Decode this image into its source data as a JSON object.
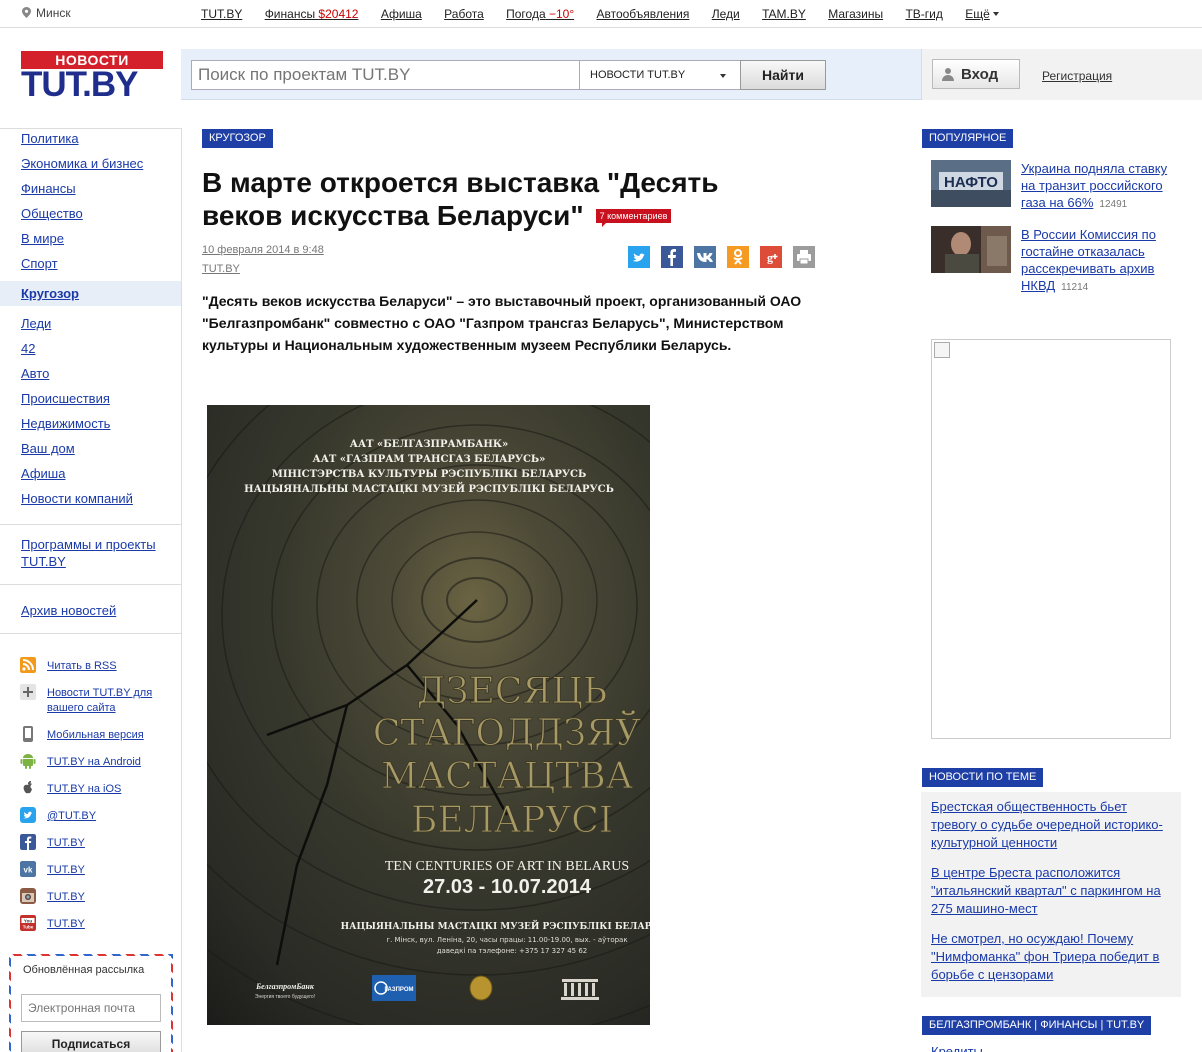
{
  "topbar": {
    "city": "Минск",
    "nav": [
      {
        "label": "TUT.BY"
      },
      {
        "label": "Финансы",
        "extra": "$20412"
      },
      {
        "label": "Афиша"
      },
      {
        "label": "Работа"
      },
      {
        "label": "Погода",
        "extra": "−10°"
      },
      {
        "label": "Автообъявления"
      },
      {
        "label": "Леди"
      },
      {
        "label": "TAM.BY"
      },
      {
        "label": "Магазины"
      },
      {
        "label": "ТВ-гид"
      },
      {
        "label": "Ещё"
      }
    ]
  },
  "header": {
    "logo_top": "НОВОСТИ",
    "logo_main": "TUT.BY",
    "search_placeholder": "Поиск по проектам TUT.BY",
    "search_scope": "НОВОСТИ TUT.BY",
    "search_button": "Найти",
    "login_button": "Вход",
    "register_link": "Регистрация"
  },
  "sidebar": {
    "nav": [
      "Политика",
      "Экономика и бизнес",
      "Финансы",
      "Общество",
      "В мире",
      "Спорт",
      "Кругозор",
      "Леди",
      "42",
      "Авто",
      "Происшествия",
      "Недвижимость",
      "Ваш дом",
      "Афиша",
      "Новости компаний"
    ],
    "active": "Кругозор",
    "programs": "Программы и проекты TUT.BY",
    "archive": "Архив новостей",
    "social": [
      {
        "icon": "rss-icon",
        "label": "Читать в RSS",
        "color": "#f29a1c"
      },
      {
        "icon": "plus-icon",
        "label": "Новости TUT.BY для вашего сайта",
        "color": "#888888"
      },
      {
        "icon": "mobile-icon",
        "label": "Мобильная версия",
        "color": "#777777"
      },
      {
        "icon": "android-icon",
        "label": "TUT.BY на Android",
        "color": "#7cb342"
      },
      {
        "icon": "apple-icon",
        "label": "TUT.BY на iOS",
        "color": "#555555"
      },
      {
        "icon": "twitter-icon",
        "label": "@TUT.BY",
        "color": "#2aa3ef"
      },
      {
        "icon": "facebook-icon",
        "label": "TUT.BY",
        "color": "#3b5998"
      },
      {
        "icon": "vk-icon",
        "label": "TUT.BY",
        "color": "#4c75a3"
      },
      {
        "icon": "instagram-icon",
        "label": "TUT.BY",
        "color": "#8a5a44"
      },
      {
        "icon": "youtube-icon",
        "label": "TUT.BY",
        "color": "#c4302b"
      }
    ],
    "subscribe_title": "Обновлённая рассылка",
    "email_placeholder": "Электронная почта",
    "subscribe_button": "Подписаться"
  },
  "article": {
    "rubric": "КРУГОЗОР",
    "title": "В марте откроется выставка \"Десять веков искусства Беларуси\"",
    "comments": "7 комментариев",
    "date": "10 февраля 2014 в 9:48",
    "source": "TUT.BY",
    "lead": "\"Десять веков искусства Беларуси\" – это выставочный проект, организованный ОАО \"Белгазпромбанк\" совместно с ОАО \"Газпром трансгаз Беларусь\", Министерством культуры и Национальным художественным музеем Республики Беларусь.",
    "share": [
      {
        "icon": "twitter-share-icon",
        "glyph": "t",
        "color": "#2aa3ef"
      },
      {
        "icon": "facebook-share-icon",
        "glyph": "f",
        "color": "#3b5998"
      },
      {
        "icon": "vk-share-icon",
        "glyph": "vk",
        "color": "#4c75a3"
      },
      {
        "icon": "odnoklassniki-share-icon",
        "glyph": "ок",
        "color": "#f59a22"
      },
      {
        "icon": "googleplus-share-icon",
        "glyph": "g+",
        "color": "#dd4b39"
      },
      {
        "icon": "print-icon",
        "glyph": "⎙",
        "color": "#999999"
      }
    ],
    "poster": {
      "org1": "ААТ «БЕЛГАЗПРАМБАНК»",
      "org2": "ААТ «ГАЗПРАМ ТРАНСГАЗ БЕЛАРУСЬ»",
      "org3": "МІНІСТЭРСТВА КУЛЬТУРЫ РЭСПУБЛІКІ БЕЛАРУСЬ",
      "org4": "НАЦЫЯНАЛЬНЫ МАСТАЦКІ МУЗЕЙ РЭСПУБЛІКІ БЕЛАРУСЬ",
      "title1": "ДЗЕСЯЦЬ",
      "title2": "СТАГОДДЗЯЎ",
      "title3": "МАСТАЦТВА",
      "title4": "БЕЛАРУСІ",
      "subtitle": "TEN CENTURIES OF ART IN BELARUS",
      "dates": "27.03 - 10.07.2014",
      "museum": "НАЦЫЯНАЛЬНЫ МАСТАЦКІ МУЗЕЙ РЭСПУБЛІКІ БЕЛАРУСЬ",
      "address": "г. Мінск, вул. Леніна, 20, часы працы: 11.00-19.00, вых. - аўторак",
      "phone": "даведкі па тэлефоне: +375 17 327 45 62",
      "sponsor": "БелгазпромБанк",
      "sponsor_tag": "Энергия твоего будущего!",
      "sponsor2": "ГАЗПРОМ"
    }
  },
  "right": {
    "popular_title": "ПОПУЛЯРНОЕ",
    "popular": [
      {
        "title": "Украина подняла ставку на транзит российского газа на 66%",
        "count": "12491"
      },
      {
        "title": "В России Комиссия по гостайне отказалась рассекречивать архив НКВД",
        "count": "11214"
      }
    ],
    "theme_title": "НОВОСТИ ПО ТЕМЕ",
    "theme": [
      "Брестская общественность бьет тревогу о судьбе очередной историко-культурной ценности",
      "В центре Бреста расположится \"итальянский квартал\" с паркингом на 275 машино-мест",
      "Не смотрел, но осуждаю! Почему \"Нимфоманка\" фон Триера победит в борьбе с цензорами"
    ],
    "partner_title": "БЕЛГАЗПРОМБАНК | ФИНАНСЫ | TUT.BY",
    "partner_first": "Кредиты"
  }
}
